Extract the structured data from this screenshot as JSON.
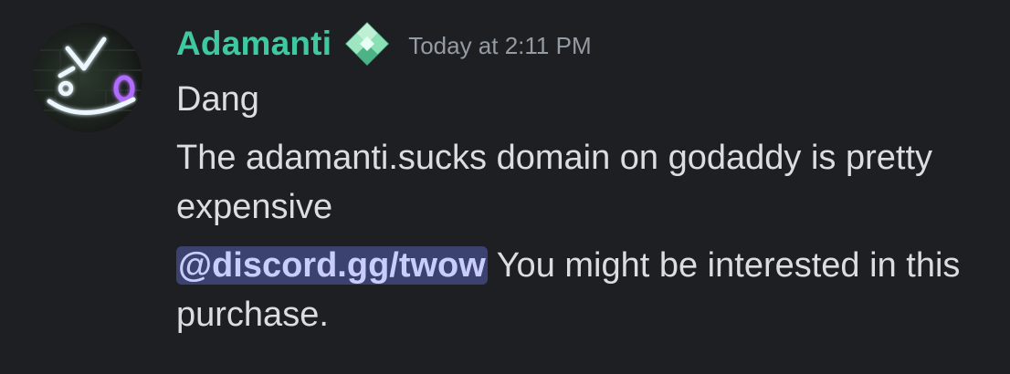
{
  "message": {
    "author": {
      "username": "Adamanti",
      "username_color": "#3fc9a3",
      "role_icon": "green-gem-icon"
    },
    "timestamp": "Today at 2:11 PM",
    "lines": [
      "Dang",
      "The adamanti.sucks domain on godaddy is pretty expensive"
    ],
    "mention_line": {
      "mention": "@discord.gg/twow",
      "text": " You might be interested in this purchase."
    }
  },
  "colors": {
    "background": "#1e1f22",
    "text": "#dbdee1",
    "timestamp": "#949ba4",
    "mention_bg": "#3c4270",
    "mention_text": "#c9cdfb"
  }
}
